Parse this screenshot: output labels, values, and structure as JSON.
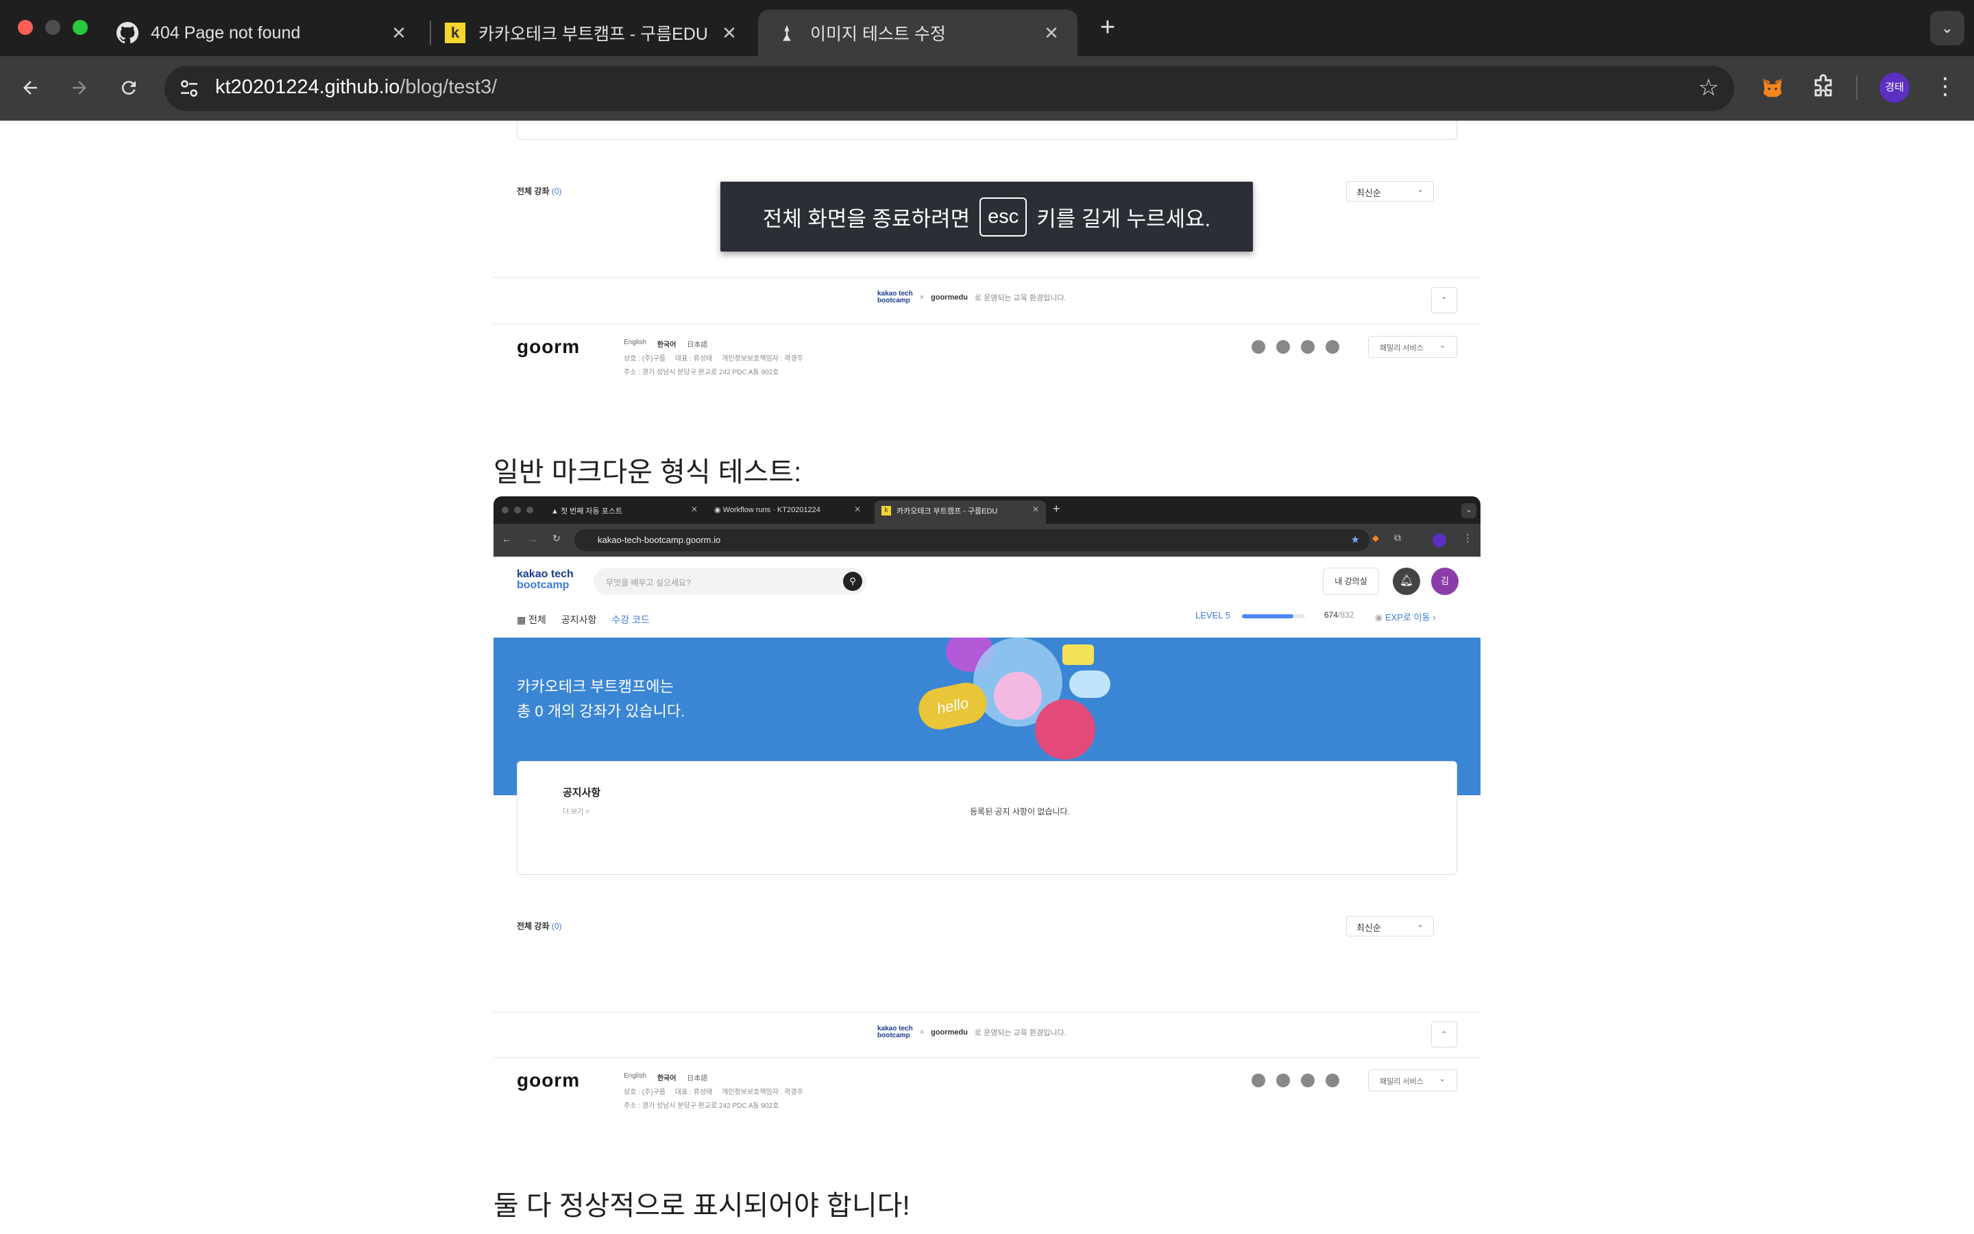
{
  "browser": {
    "tabs": [
      {
        "title": "404 Page not found",
        "icon": "github-icon"
      },
      {
        "title": "카카오테크 부트캠프 - 구름EDU",
        "icon": "kakao-k-icon"
      },
      {
        "title": "이미지 테스트 수정",
        "icon": "jekyll-icon",
        "active": true
      }
    ],
    "new_tab": "+",
    "url_host": "kt20201224.github.io",
    "url_path": "/blog/test3/",
    "profile_initials": "경태"
  },
  "fullscreen_notice": {
    "before": "전체 화면을 종료하려면",
    "key": "esc",
    "after": "키를 길게 누르세요."
  },
  "top_snippet": {
    "all_courses_label": "전체 강좌",
    "all_courses_count": "(0)",
    "sort_label": "최신순",
    "footer_banner": {
      "brand_top": "kakao tech",
      "brand_bottom": "bootcamp",
      "x": "×",
      "goormedu": "goormedu",
      "text": "로 운영되는 교육 환경입니다."
    },
    "goorm_logo": "goorm",
    "langs": [
      "English",
      "한국어",
      "日本語"
    ],
    "company_line": "상호 : (주)구름     대표 : 류성태     개인정보보호책임자 : 곽경주",
    "address_line": "주소 : 경기 성남시 분당구 판교로 242 PDC A동 902호",
    "family_service": "패밀리 서비스"
  },
  "heading1": "일반 마크다운 형식 테스트:",
  "embedded": {
    "tabs": [
      {
        "title": "첫 번째 자동 포스트"
      },
      {
        "title": "Workflow runs · KT20201224"
      },
      {
        "title": "카카오테크 부트캠프 - 구름EDU"
      }
    ],
    "url": "kakao-tech-bootcamp.goorm.io",
    "logo_top": "kakao tech",
    "logo_bottom": "bootcamp",
    "search_placeholder": "무엇을 배우고 싶으세요?",
    "my_class": "내 강의실",
    "avatar": "김",
    "nav": [
      "전체",
      "공지사항",
      "수강 코드"
    ],
    "level": "LEVEL 5",
    "exp_current": "674",
    "exp_total": "/832",
    "exp_progress": 0.81,
    "exp_link": "EXP로 이동",
    "banner_line1": "카카오테크 부트캠프에는",
    "banner_line2": "총 0 개의 강좌가 있습니다.",
    "banner_sticker": "hello",
    "notice_title": "공지사항",
    "notice_more": "더 보기 >",
    "notice_empty": "등록된 공지 사항이 없습니다.",
    "all_courses_label": "전체 강좌",
    "all_courses_count": "(0)",
    "sort_label": "최신순"
  },
  "heading2": "둘 다 정상적으로 표시되어야 합니다!",
  "colors": {
    "tab_bg": "#1f1f1f",
    "toolbar_bg": "#3c3c3c",
    "banner_blue": "#3a86d4",
    "link_blue": "#3b7bd8",
    "avatar_purple": "#8a3ca8"
  }
}
